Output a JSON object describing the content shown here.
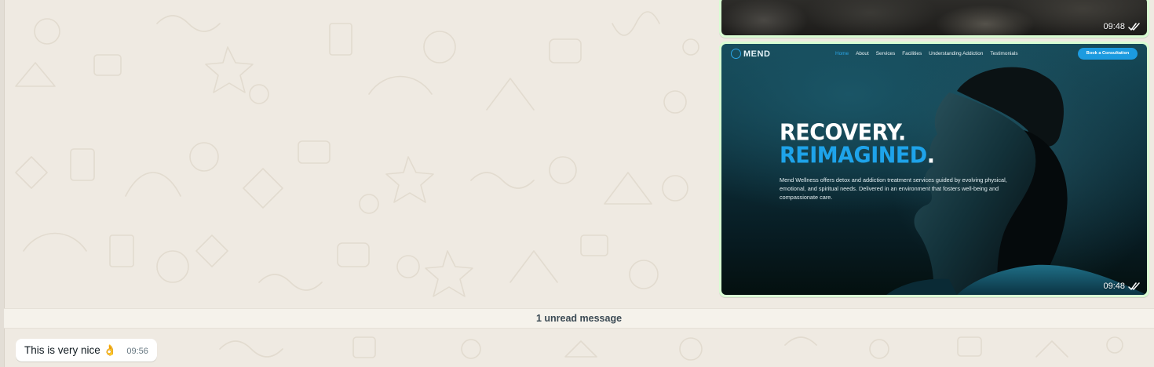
{
  "messages": [
    {
      "type": "image",
      "direction": "outgoing",
      "time": "09:48",
      "status_icon": "double-check-icon"
    },
    {
      "type": "image",
      "direction": "outgoing",
      "time": "09:48",
      "status_icon": "double-check-icon",
      "website": {
        "logo_text": "MEND",
        "nav_links": [
          "Home",
          "About",
          "Services",
          "Facilities",
          "Understanding Addiction",
          "Testimonials"
        ],
        "active_link": "Home",
        "cta_label": "Book a Consultation",
        "headline_line1": "RECOVERY",
        "headline_line2": "REIMAGINED",
        "body_text": "Mend Wellness offers detox and addiction treatment services guided by evolving physical, emotional, and spiritual needs. Delivered in an environment that fosters well-being and compassionate care.",
        "accent_color": "#1ea3ea"
      }
    },
    {
      "type": "divider",
      "text": "1 unread message"
    },
    {
      "type": "text",
      "direction": "incoming",
      "text": "This is very nice 👌",
      "time": "09:56"
    }
  ],
  "colors": {
    "chat_background": "#efeae2",
    "outgoing_bubble": "#d9fdd3",
    "incoming_bubble": "#ffffff"
  }
}
